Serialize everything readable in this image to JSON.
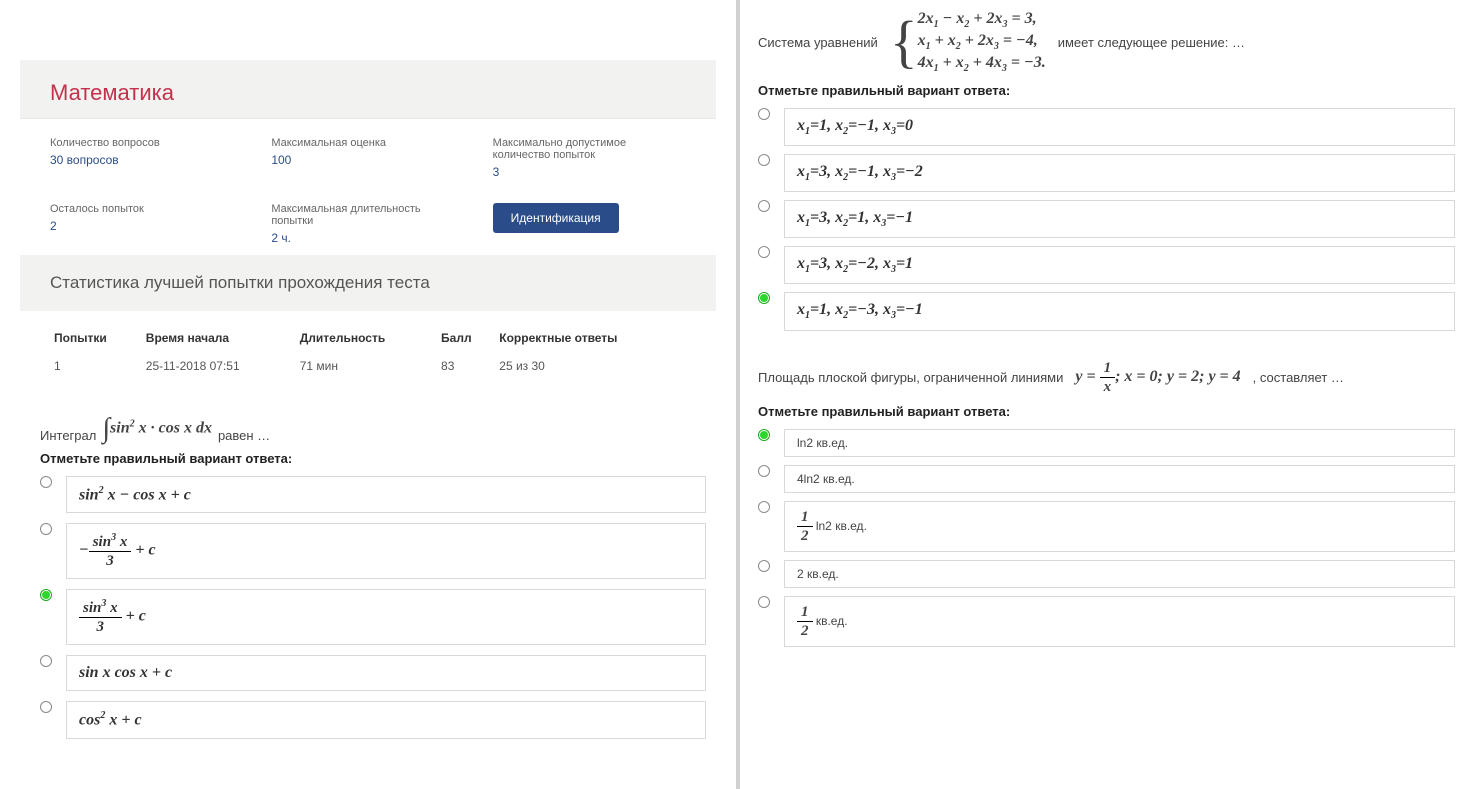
{
  "header": {
    "title": "Математика"
  },
  "info": {
    "q_count_label": "Количество вопросов",
    "q_count_value": "30 вопросов",
    "max_score_label": "Максимальная оценка",
    "max_score_value": "100",
    "max_attempts_label": "Максимально допустимое количество попыток",
    "max_attempts_value": "3",
    "remaining_label": "Осталось попыток",
    "remaining_value": "2",
    "max_duration_label": "Максимальная длительность попытки",
    "max_duration_value": "2 ч.",
    "id_button": "Идентификация"
  },
  "stats": {
    "heading": "Статистика лучшей попытки прохождения теста",
    "cols": {
      "attempts": "Попытки",
      "start": "Время начала",
      "duration": "Длительность",
      "score": "Балл",
      "correct": "Корректные ответы"
    },
    "row": {
      "attempts": "1",
      "start": "25-11-2018 07:51",
      "duration": "71 мин",
      "score": "83",
      "correct": "25 из 30"
    }
  },
  "q1": {
    "prefix": "Интеграл",
    "suffix": "равен …",
    "integral_expr": "sin² x · cos x dx",
    "instruction": "Отметьте правильный вариант ответа:",
    "selected_index": 2,
    "options_math": [
      "sin² x − cos x + c",
      "−(sin³ x / 3) + c",
      "(sin³ x / 3) + c",
      "sin x cos x + c",
      "cos² x + c"
    ]
  },
  "q2": {
    "prefix": "Система уравнений",
    "equations": [
      "2x₁ − x₂ + 2x₃ = 3,",
      "x₁ + x₂ + 2x₃ = −4,",
      "4x₁ + x₂ + 4x₃ = −3."
    ],
    "suffix": "имеет следующее решение: …",
    "instruction": "Отметьте правильный вариант ответа:",
    "selected_index": 4,
    "options_math": [
      "x₁ = 1, x₂ = −1, x₃ = 0",
      "x₁ = 3, x₂ = −1, x₃ = −2",
      "x₁ = 3, x₂ = 1, x₃ = −1",
      "x₁ = 3, x₂ = −2, x₃ = 1",
      "x₁ = 1, x₂ = −3, x₃ = −1"
    ]
  },
  "q3": {
    "prefix": "Площадь плоской фигуры, ограниченной линиями",
    "curve_expr": "y = 1/x; x = 0; y = 2; y = 4",
    "suffix": ", составляет …",
    "instruction": "Отметьте правильный вариант ответа:",
    "selected_index": 0,
    "options": [
      "ln2 кв.ед.",
      "4ln2 кв.ед.",
      "½ ln2 кв.ед.",
      "2 кв.ед.",
      "½ кв.ед."
    ]
  }
}
